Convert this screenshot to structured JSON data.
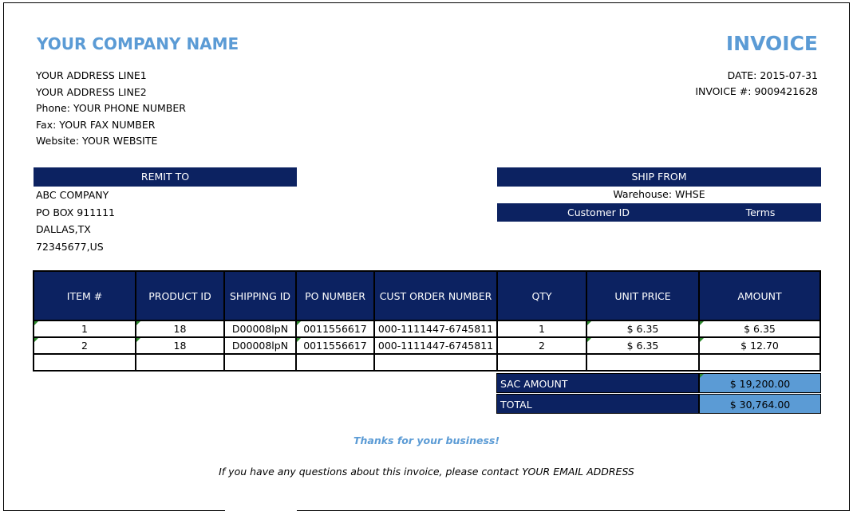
{
  "company": {
    "name": "YOUR COMPANY NAME",
    "address_lines": [
      "YOUR ADDRESS LINE1",
      "YOUR ADDRESS LINE2",
      "Phone: YOUR PHONE NUMBER",
      "Fax: YOUR FAX NUMBER",
      "Website: YOUR WEBSITE"
    ]
  },
  "invoice": {
    "title": "INVOICE",
    "date": "DATE: 2015-07-31",
    "number": "INVOICE #: 9009421628"
  },
  "remit_to": {
    "header": "REMIT TO",
    "lines": [
      "ABC COMPANY",
      "PO BOX 911111",
      "DALLAS,TX",
      "72345677,US"
    ]
  },
  "ship_from": {
    "header": "SHIP FROM",
    "warehouse": "Warehouse: WHSE",
    "customer_id_label": "Customer ID",
    "terms_label": "Terms"
  },
  "table": {
    "headers": [
      "ITEM #",
      "PRODUCT ID",
      "SHIPPING ID",
      "PO NUMBER",
      "CUST ORDER NUMBER",
      "QTY",
      "UNIT PRICE",
      "AMOUNT"
    ],
    "rows": [
      [
        "1",
        "18",
        "D00008lpN",
        "0011556617",
        "000-1111447-6745811",
        "1",
        "$ 6.35",
        "$ 6.35"
      ],
      [
        "2",
        "18",
        "D00008lpN",
        "0011556617",
        "000-1111447-6745811",
        "2",
        "$ 6.35",
        "$ 12.70"
      ],
      [
        "",
        "",
        "",
        "",
        "",
        "",
        "",
        ""
      ]
    ]
  },
  "totals": {
    "sac_label": "SAC AMOUNT",
    "sac_value": "$ 19,200.00",
    "total_label": "TOTAL",
    "total_value": "$ 30,764.00"
  },
  "footer": {
    "thanks": "Thanks for your business!",
    "contact": "If you have any questions about this invoice, please contact YOUR EMAIL ADDRESS"
  },
  "colors": {
    "accent": "#5b9bd5",
    "header_bg": "#0c2261",
    "total_bg": "#5b9bd5"
  }
}
